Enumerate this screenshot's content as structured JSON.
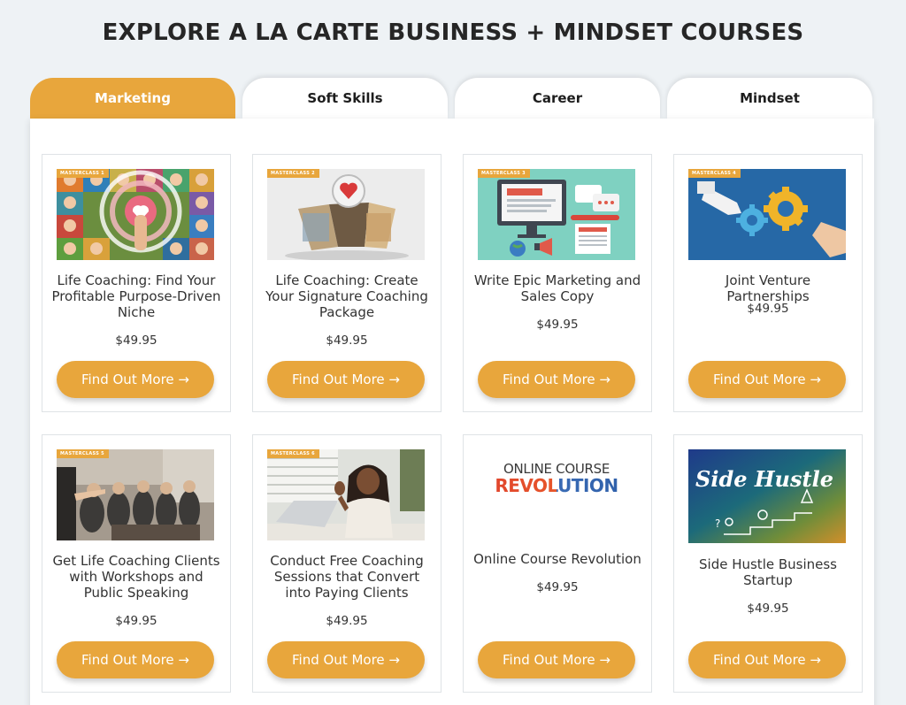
{
  "page": {
    "title": "EXPLORE A LA CARTE BUSINESS + MINDSET COURSES"
  },
  "tabs": [
    {
      "label": "Marketing",
      "active": true
    },
    {
      "label": "Soft Skills",
      "active": false
    },
    {
      "label": "Career",
      "active": false
    },
    {
      "label": "Mindset",
      "active": false
    }
  ],
  "colors": {
    "accent": "#e8a63c",
    "page_bg": "#eef2f5",
    "card_border": "#dfe3e6"
  },
  "courses": [
    {
      "badge": "MASTERCLASS 1",
      "title": "Life Coaching: Find Your Profitable Purpose-Driven Niche",
      "price": "$49.95",
      "button": "Find Out More →"
    },
    {
      "badge": "MASTERCLASS 2",
      "title": "Life Coaching: Create Your Signature Coaching Package",
      "price": "$49.95",
      "button": "Find Out More →"
    },
    {
      "badge": "MASTERCLASS 3",
      "title": "Write Epic Marketing and Sales Copy",
      "price": "$49.95",
      "button": "Find Out More →"
    },
    {
      "badge": "MASTERCLASS 4",
      "title": "Joint Venture Partnerships",
      "price": "$49.95",
      "button": "Find Out More →"
    },
    {
      "badge": "MASTERCLASS 5",
      "title": "Get Life Coaching Clients with Workshops and Public Speaking",
      "price": "$49.95",
      "button": "Find Out More →"
    },
    {
      "badge": "MASTERCLASS 6",
      "title": "Conduct Free Coaching Sessions that Convert into Paying Clients",
      "price": "$49.95",
      "button": "Find Out More →"
    },
    {
      "logo_line1": "ONLINE COURSE",
      "logo_line2": "REVOLUTION",
      "title": "Online Course Revolution",
      "price": "$49.95",
      "button": "Find Out More →"
    },
    {
      "image_text": "Side Hustle",
      "title": "Side Hustle Business Startup",
      "price": "$49.95",
      "button": "Find Out More →"
    }
  ]
}
